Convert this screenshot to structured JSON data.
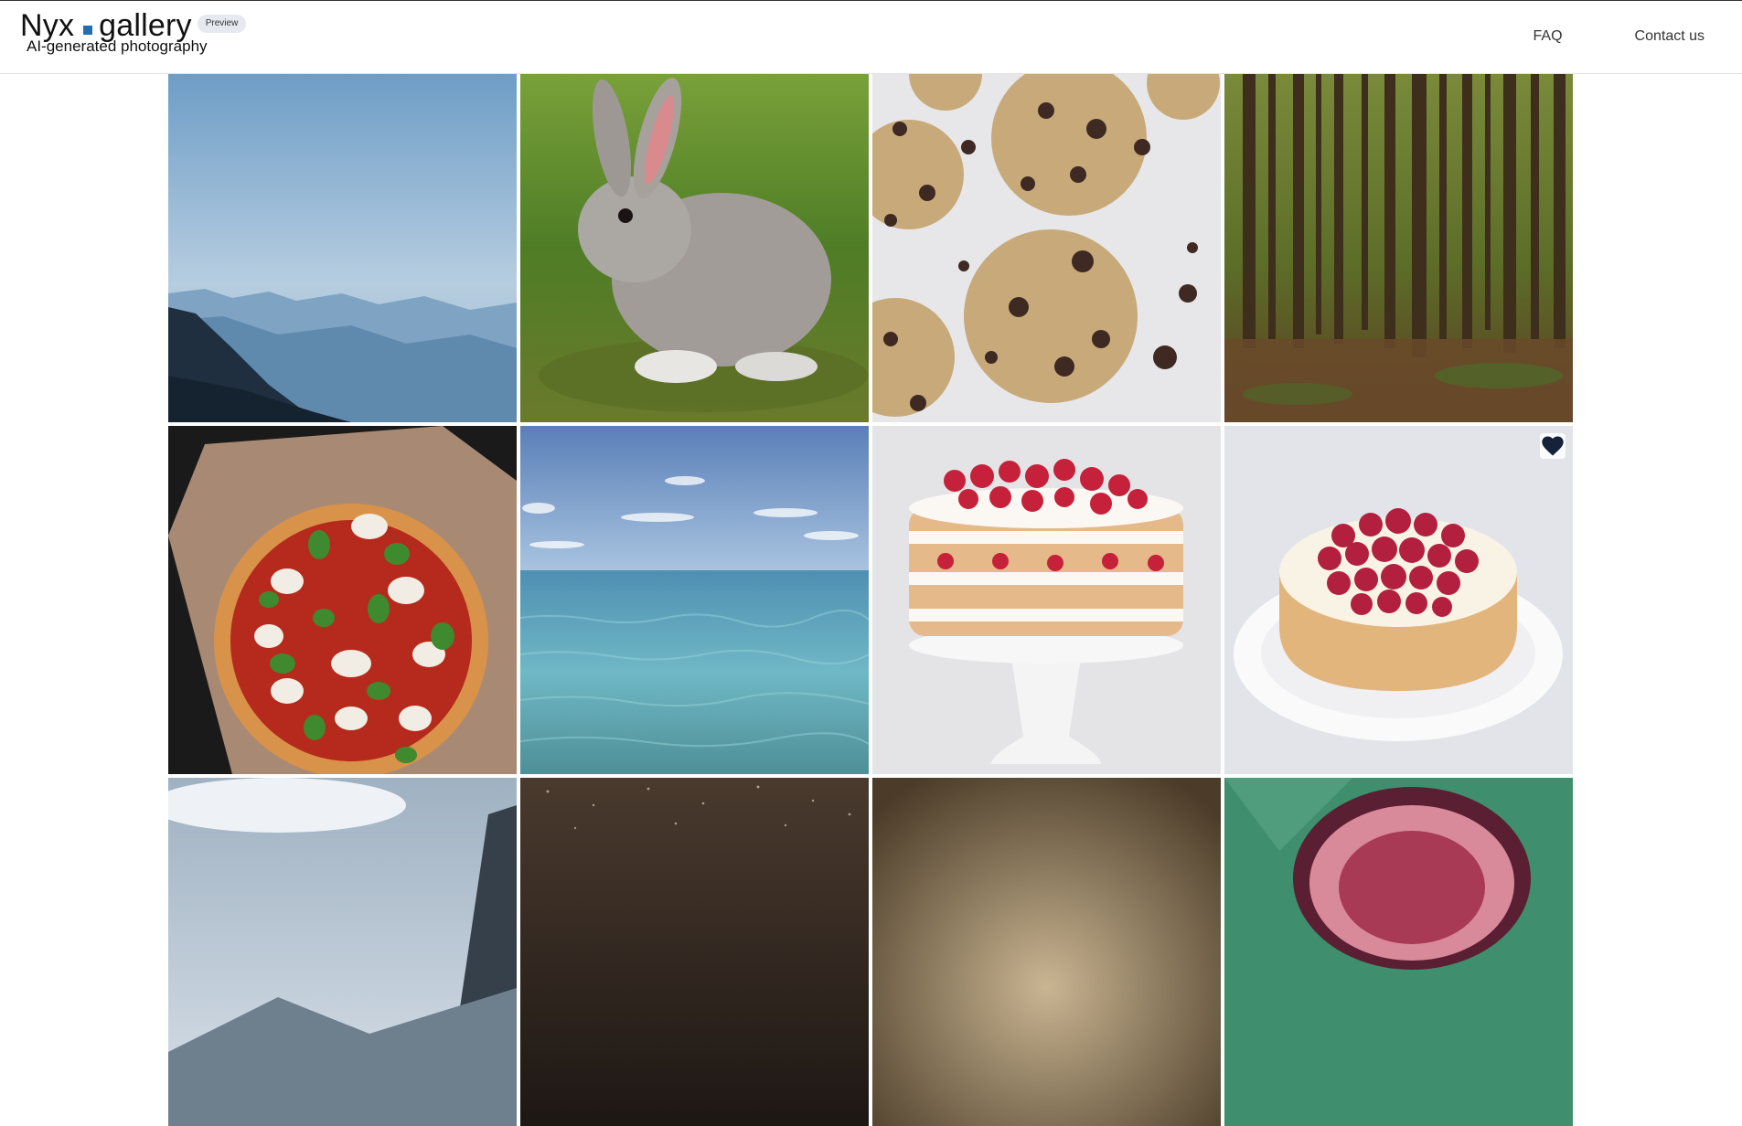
{
  "brand": {
    "word1": "Nyx",
    "word2": "gallery",
    "badge": "Preview",
    "tagline": "AI-generated photography",
    "accent": "#1f6fb2"
  },
  "nav": {
    "faq": "FAQ",
    "contact": "Contact us"
  },
  "gallery": {
    "images": [
      {
        "subject": "hazy blue mountain ridges",
        "favorited": false
      },
      {
        "subject": "grey rabbit on grass",
        "favorited": false
      },
      {
        "subject": "chocolate chip cookies",
        "favorited": false
      },
      {
        "subject": "pine forest",
        "favorited": false
      },
      {
        "subject": "margherita pizza with basil",
        "favorited": false
      },
      {
        "subject": "turquoise ocean under blue sky",
        "favorited": false
      },
      {
        "subject": "layered strawberry cream cake on stand",
        "favorited": false
      },
      {
        "subject": "raspberry tart on white plate",
        "favorited": true
      },
      {
        "subject": "cloudy mountain landscape",
        "favorited": false
      },
      {
        "subject": "dark speckled sky",
        "favorited": false
      },
      {
        "subject": "brown gradient backdrop",
        "favorited": false
      },
      {
        "subject": "cut fig on green leaf",
        "favorited": false
      }
    ]
  }
}
